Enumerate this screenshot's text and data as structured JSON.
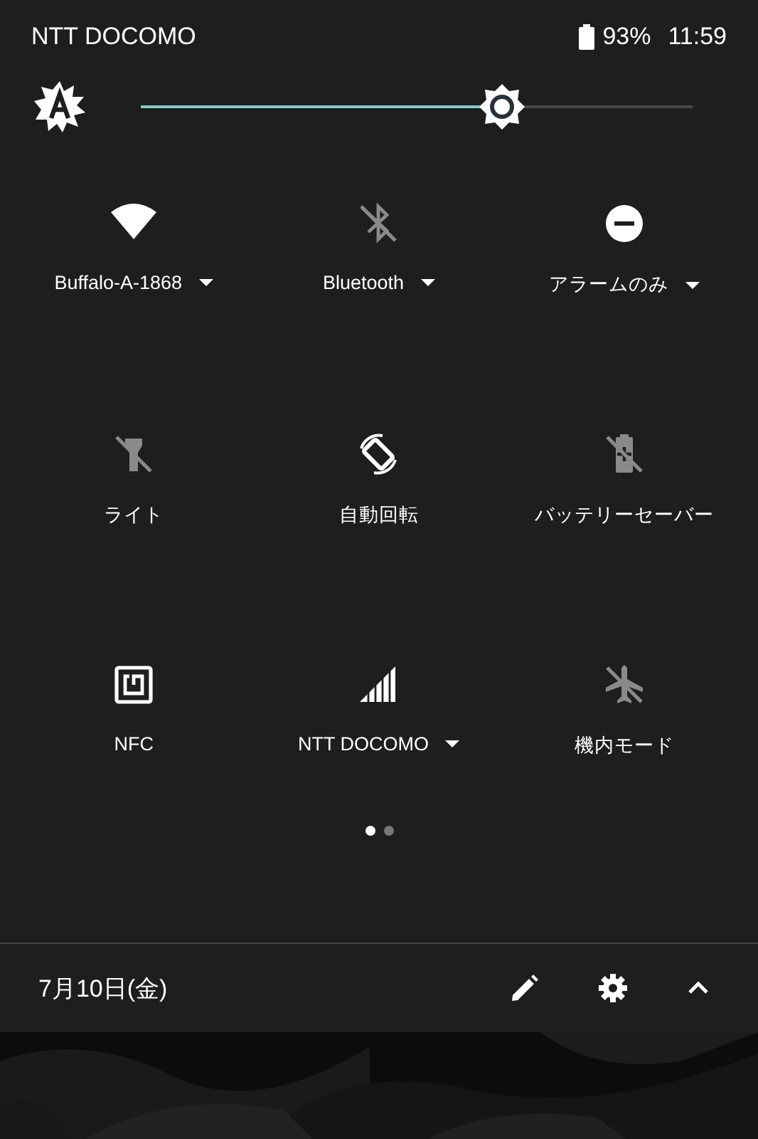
{
  "status_bar": {
    "carrier": "NTT DOCOMO",
    "battery": "93%",
    "time": "11:59"
  },
  "brightness": {
    "auto": true,
    "level": 0.655
  },
  "tiles": [
    {
      "kind": "wifi",
      "label": "Buffalo-A-1868",
      "on": true,
      "dropdown": true
    },
    {
      "kind": "bluetooth",
      "label": "Bluetooth",
      "on": false,
      "dropdown": true
    },
    {
      "kind": "dnd",
      "label": "アラームのみ",
      "on": true,
      "dropdown": true
    },
    {
      "kind": "flashlight",
      "label": "ライト",
      "on": false,
      "dropdown": false
    },
    {
      "kind": "rotate",
      "label": "自動回転",
      "on": true,
      "dropdown": false
    },
    {
      "kind": "battery",
      "label": "バッテリーセーバー",
      "on": false,
      "dropdown": false
    },
    {
      "kind": "nfc",
      "label": "NFC",
      "on": true,
      "dropdown": false
    },
    {
      "kind": "cellular",
      "label": "NTT DOCOMO",
      "on": true,
      "dropdown": true
    },
    {
      "kind": "airplane",
      "label": "機内モード",
      "on": false,
      "dropdown": false
    }
  ],
  "pages": [
    {
      "selected": true
    },
    {
      "selected": false
    }
  ],
  "footer": {
    "date": "7月10日(金)"
  }
}
